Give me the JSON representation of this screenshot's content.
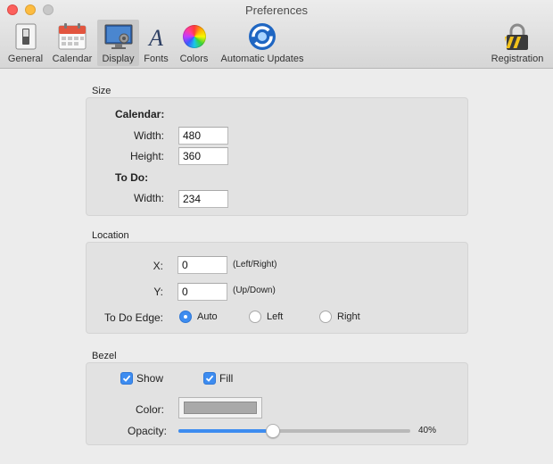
{
  "window": {
    "title": "Preferences"
  },
  "toolbar": {
    "items": [
      {
        "label": "General",
        "icon": "switch-icon"
      },
      {
        "label": "Calendar",
        "icon": "calendar-icon"
      },
      {
        "label": "Display",
        "icon": "display-icon",
        "selected": true
      },
      {
        "label": "Fonts",
        "icon": "font-icon"
      },
      {
        "label": "Colors",
        "icon": "color-wheel-icon"
      },
      {
        "label": "Automatic Updates",
        "icon": "sync-icon"
      },
      {
        "label": "Registration",
        "icon": "padlock-icon"
      }
    ]
  },
  "size": {
    "title": "Size",
    "calendar_heading": "Calendar:",
    "width_label": "Width:",
    "width_value": "480",
    "height_label": "Height:",
    "height_value": "360",
    "todo_heading": "To Do:",
    "todo_width_label": "Width:",
    "todo_width_value": "234"
  },
  "location": {
    "title": "Location",
    "x_label": "X:",
    "x_value": "0",
    "x_hint": "(Left/Right)",
    "y_label": "Y:",
    "y_value": "0",
    "y_hint": "(Up/Down)",
    "edge_label": "To Do Edge:",
    "edge_options": [
      {
        "label": "Auto",
        "selected": true
      },
      {
        "label": "Left",
        "selected": false
      },
      {
        "label": "Right",
        "selected": false
      }
    ]
  },
  "bezel": {
    "title": "Bezel",
    "show_label": "Show",
    "show_checked": true,
    "fill_label": "Fill",
    "fill_checked": true,
    "color_label": "Color:",
    "color_value": "#a9a9a9",
    "opacity_label": "Opacity:",
    "opacity_percent": 40,
    "opacity_text": "40%"
  },
  "colors": {
    "accent": "#3d8cf0"
  }
}
